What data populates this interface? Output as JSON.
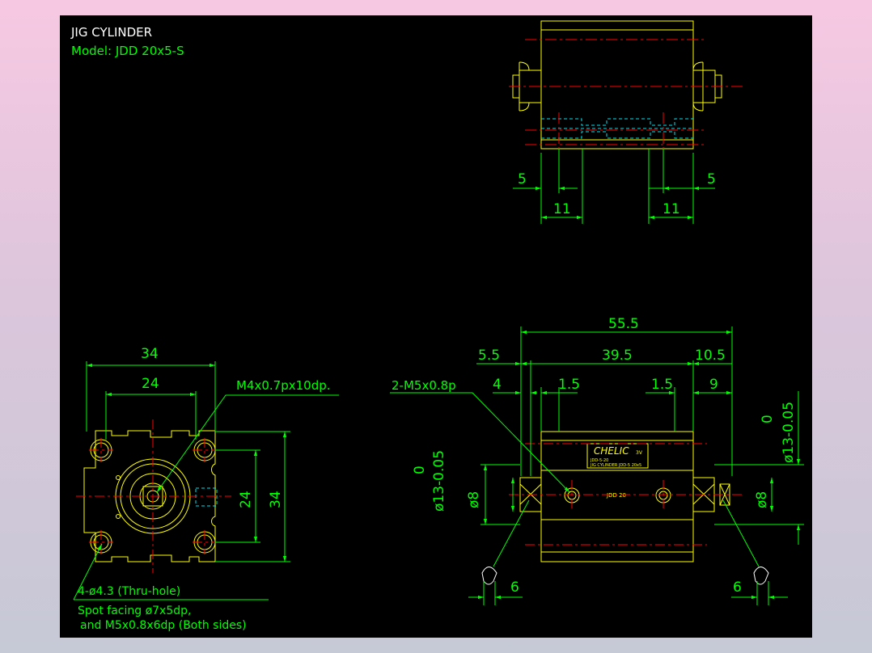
{
  "title": "JIG CYLINDER",
  "model": "Model:  JDD 20x5-S",
  "colors": {
    "background": "#000000",
    "part": "#ffff00",
    "dimension": "#00ff00",
    "centerline": "#ff0000",
    "hidden": "#00e5ee",
    "title_text": "#ffffff"
  },
  "top_view": {
    "dim_left_offset": "5",
    "dim_right_offset": "5",
    "dim_left_width": "11",
    "dim_right_width": "11"
  },
  "end_view": {
    "dim_width_outer": "34",
    "dim_width_inner": "24",
    "dim_height_inner": "24",
    "dim_height_outer": "34",
    "tap_callout": "M4x0.7px10dp.",
    "hole_callout": "4-ø4.3 (Thru-hole)",
    "note_line1": "Spot facing ø7x5dp,",
    "note_line2": "and M5x0.8x6dp (Both sides)"
  },
  "side_view": {
    "dim_overall": "55.5",
    "dim_left": "5.5",
    "dim_body": "39.5",
    "dim_right": "10.5",
    "dim_4": "4",
    "dim_1_5_left": "1.5",
    "dim_1_5_right": "1.5",
    "dim_9": "9",
    "port_callout": "2-M5x0.8p",
    "dim_rod_tol_left_upper": "0",
    "dim_rod_tol_left": "ø13-0.05",
    "dim_rod_tol_right_upper": "0",
    "dim_rod_tol_right": "ø13-0.05",
    "dim_d8_left": "ø8",
    "dim_d8_right": "ø8",
    "dim_wrench_left": "6",
    "dim_wrench_right": "6",
    "body_label": "JDD 20",
    "brand_label": "CHELIC",
    "brand_tag": "3V",
    "nameplate_line1": "JDD-5-20",
    "nameplate_line2": "JIG CYLINDER JDD-5 20x5"
  }
}
